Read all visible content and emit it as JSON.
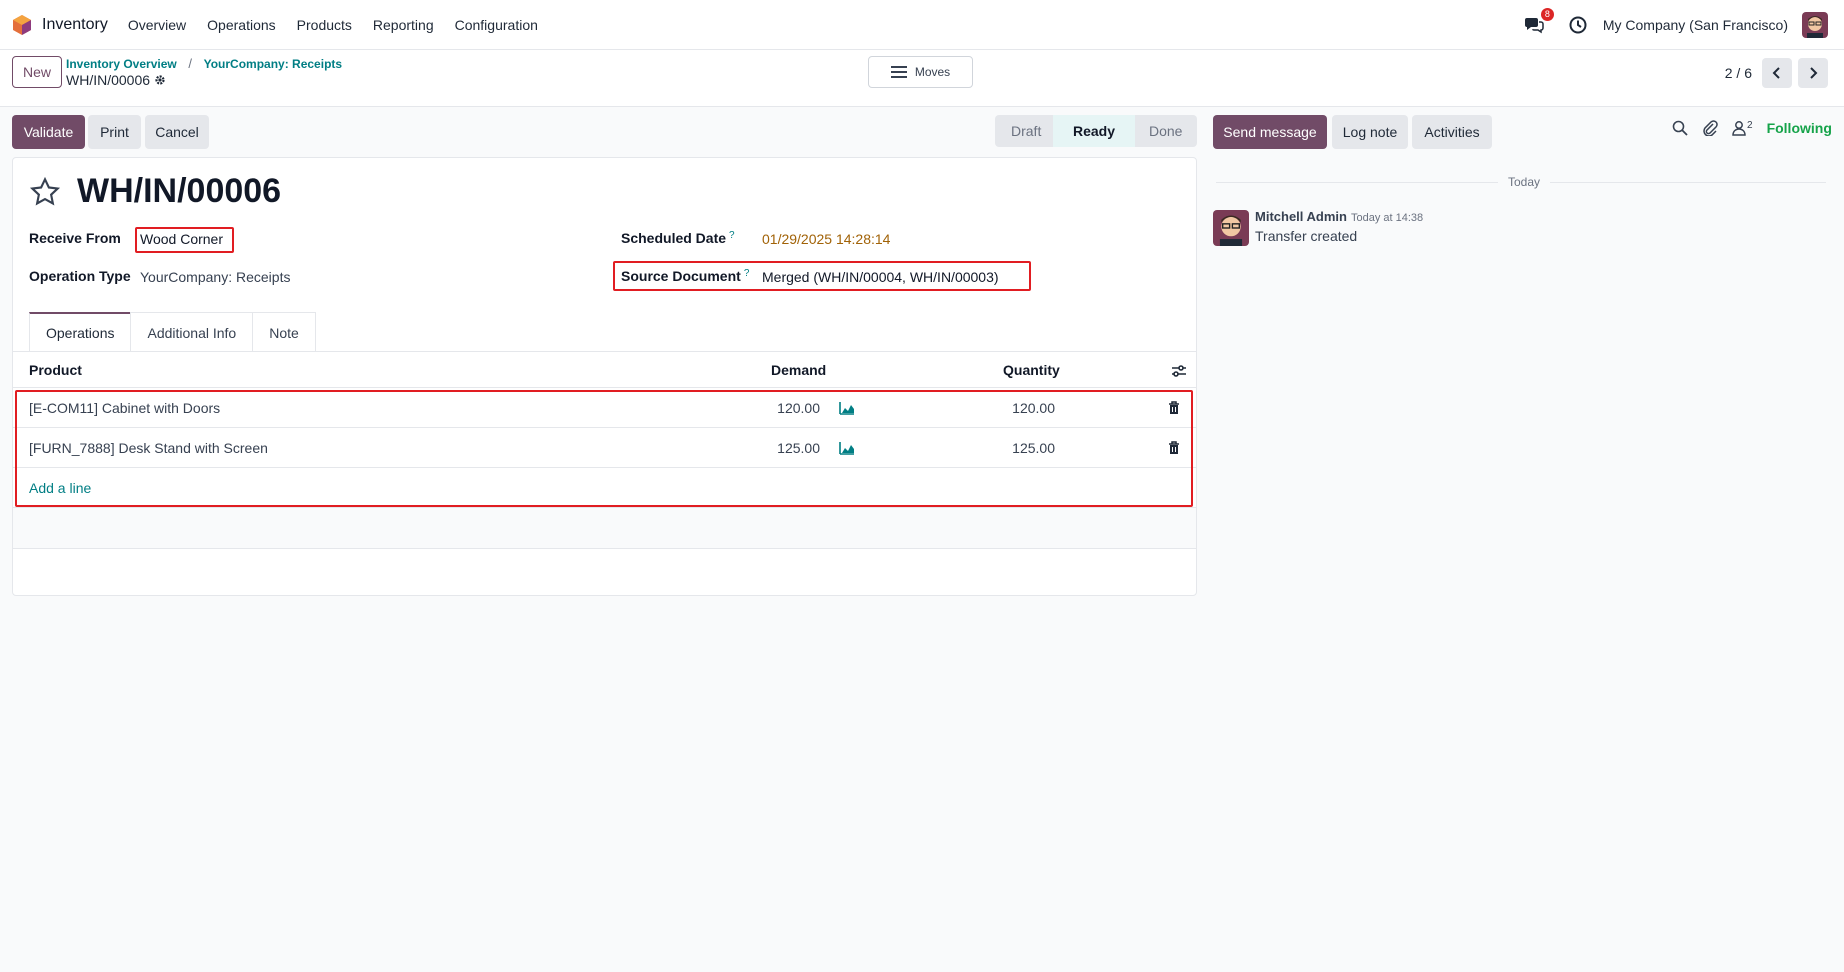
{
  "nav": {
    "app_name": "Inventory",
    "menu": [
      "Overview",
      "Operations",
      "Products",
      "Reporting",
      "Configuration"
    ],
    "messages_badge": "8",
    "company": "My Company (San Francisco)"
  },
  "control": {
    "new_label": "New",
    "breadcrumbs": [
      "Inventory Overview",
      "YourCompany: Receipts"
    ],
    "breadcrumb_sep": "/",
    "current_record": "WH/IN/00006",
    "moves_label": "Moves",
    "pager": "2 / 6"
  },
  "actions": {
    "validate": "Validate",
    "print": "Print",
    "cancel": "Cancel"
  },
  "status": {
    "stages": [
      "Draft",
      "Ready",
      "Done"
    ],
    "current": "Ready"
  },
  "form": {
    "title": "WH/IN/00006",
    "receive_from_label": "Receive From",
    "receive_from": "Wood Corner",
    "operation_type_label": "Operation Type",
    "operation_type": "YourCompany: Receipts",
    "scheduled_date_label": "Scheduled Date",
    "scheduled_date": "01/29/2025 14:28:14",
    "source_document_label": "Source Document",
    "source_document": "Merged (WH/IN/00004, WH/IN/00003)",
    "help_mark": "?"
  },
  "tabs": [
    "Operations",
    "Additional Info",
    "Note"
  ],
  "table": {
    "headers": {
      "product": "Product",
      "demand": "Demand",
      "quantity": "Quantity"
    },
    "rows": [
      {
        "product": "[E-COM11] Cabinet with Doors",
        "demand": "120.00",
        "quantity": "120.00"
      },
      {
        "product": "[FURN_7888] Desk Stand with Screen",
        "demand": "125.00",
        "quantity": "125.00"
      }
    ],
    "add_line": "Add a line"
  },
  "chatter": {
    "send_message": "Send message",
    "log_note": "Log note",
    "activities": "Activities",
    "followers_count": "2",
    "following": "Following",
    "today": "Today",
    "message": {
      "author": "Mitchell Admin",
      "time": "Today at 14:38",
      "body": "Transfer created"
    }
  },
  "colors": {
    "primary": "#714b67",
    "link": "#017e84",
    "highlight": "#e11d22",
    "scheduled_date": "#a16207",
    "following": "#16a34a"
  }
}
